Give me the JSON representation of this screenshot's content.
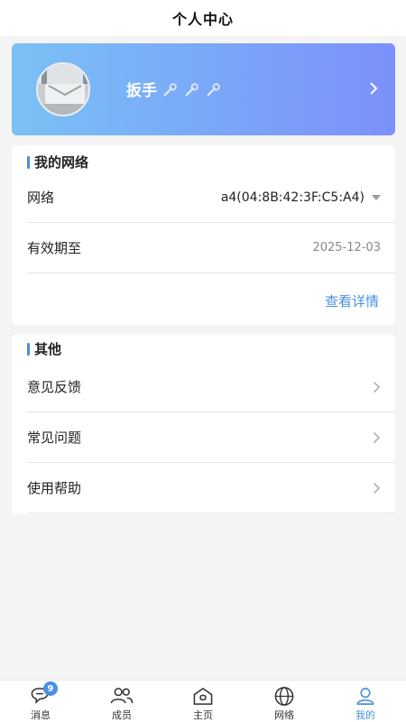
{
  "header": {
    "title": "个人中心"
  },
  "profile": {
    "name": "扳手",
    "wrench_count": 3
  },
  "network_section": {
    "title": "我的网络",
    "network_label": "网络",
    "network_value": "a4(04:8B:42:3F:C5:A4)",
    "expiry_label": "有效期至",
    "expiry_value": "2025-12-03",
    "details_link": "查看详情"
  },
  "other_section": {
    "title": "其他",
    "items": [
      {
        "label": "意见反馈"
      },
      {
        "label": "常见问题"
      },
      {
        "label": "使用帮助"
      }
    ]
  },
  "tabbar": {
    "tabs": [
      {
        "label": "消息",
        "icon": "message-icon",
        "badge": "9"
      },
      {
        "label": "成员",
        "icon": "members-icon"
      },
      {
        "label": "主页",
        "icon": "home-icon"
      },
      {
        "label": "网络",
        "icon": "globe-icon"
      },
      {
        "label": "我的",
        "icon": "user-icon",
        "active": true
      }
    ]
  },
  "colors": {
    "accent": "#4a90e2",
    "card_gradient_start": "#7ac1f5",
    "card_gradient_end": "#7b90fb"
  }
}
